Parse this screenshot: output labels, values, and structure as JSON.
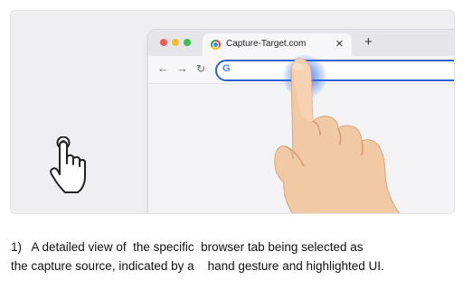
{
  "browser": {
    "tab": {
      "title": "Capture-Target.com",
      "close_icon": "close-icon"
    },
    "new_tab_icon": "plus-icon",
    "nav": {
      "back_icon": "arrow-left-icon",
      "forward_icon": "arrow-right-icon",
      "reload_icon": "reload-icon"
    },
    "omnibox": {
      "value": "",
      "icon": "google-g-icon",
      "icon_glyph": "G"
    },
    "highlight_color": "#3c6eff"
  },
  "caption": {
    "line1": "1)   A detailed view of  the specific  browser tab being selected as",
    "line2": "the capture source, indicated by a    hand gesture and highlighted UI."
  }
}
